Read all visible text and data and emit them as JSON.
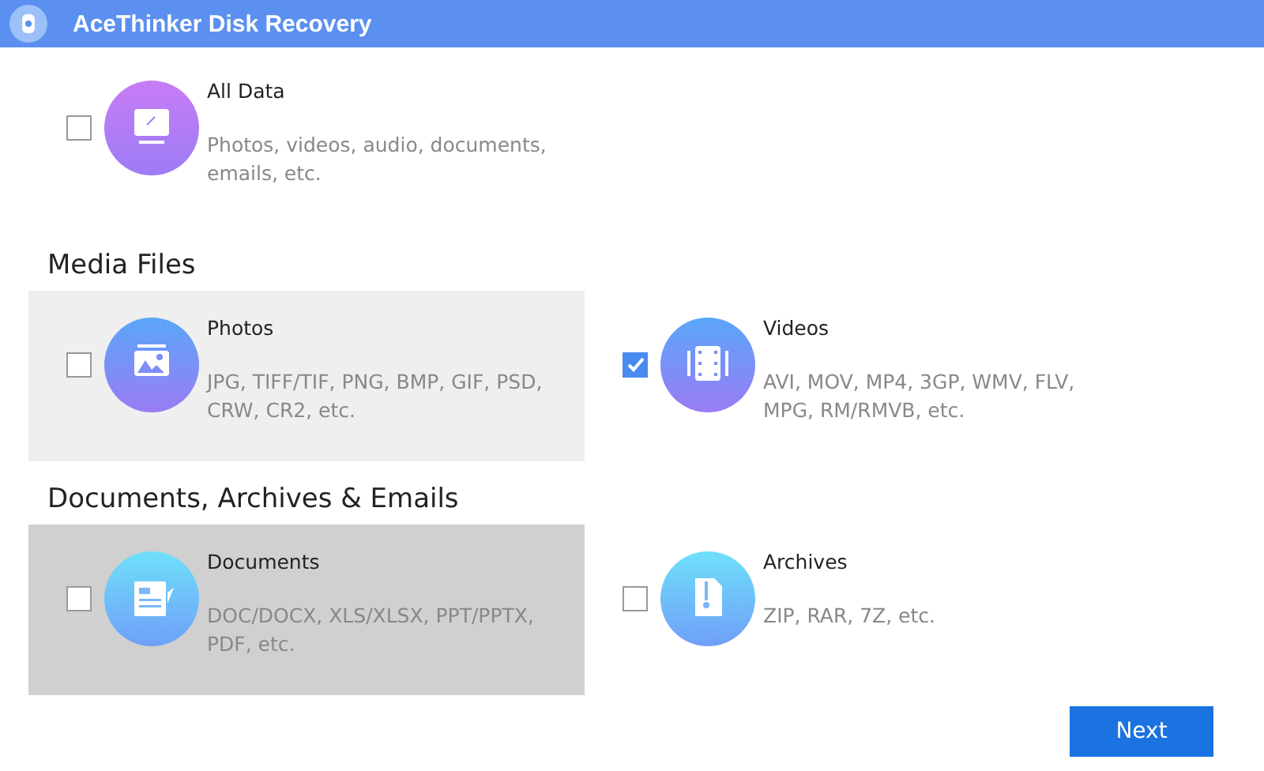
{
  "window": {
    "title": "AceThinker Disk Recovery"
  },
  "all_data": {
    "kind": "monitor",
    "title": "All Data",
    "description": "Photos, videos, audio, documents, emails, etc.",
    "checked": false,
    "hovered": false,
    "pressed": false
  },
  "sections": [
    {
      "heading": "Media Files",
      "items": [
        {
          "kind": "photo",
          "title": "Photos",
          "description": "JPG, TIFF/TIF, PNG, BMP, GIF, PSD, CRW, CR2, etc.",
          "checked": false,
          "hovered": true,
          "pressed": false
        },
        {
          "kind": "film",
          "title": "Videos",
          "description": "AVI, MOV, MP4, 3GP, WMV, FLV, MPG, RM/RMVB, etc.",
          "checked": true,
          "hovered": false,
          "pressed": false
        }
      ]
    },
    {
      "heading": "Documents, Archives & Emails",
      "items": [
        {
          "kind": "document",
          "title": "Documents",
          "description": "DOC/DOCX, XLS/XLSX, PPT/PPTX, PDF, etc.",
          "checked": false,
          "hovered": false,
          "pressed": true
        },
        {
          "kind": "zip",
          "title": "Archives",
          "description": "ZIP, RAR, 7Z, etc.",
          "checked": false,
          "hovered": false,
          "pressed": false
        }
      ]
    }
  ],
  "next_button": {
    "label": "Next"
  }
}
